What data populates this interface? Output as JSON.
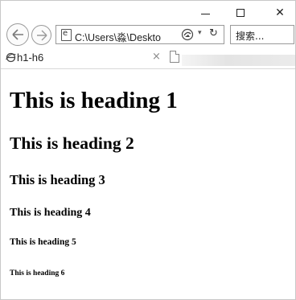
{
  "window": {
    "minimize_icon": "minimize-icon",
    "maximize_icon": "maximize-icon",
    "close_label": "✕"
  },
  "navigation": {
    "back_icon": "back-arrow-icon",
    "forward_icon": "forward-arrow-icon",
    "address": "C:\\Users\\淼\\Deskto",
    "compat_icon": "compatibility-view-icon",
    "dropdown_label": "▾",
    "refresh_label": "↻",
    "search_placeholder": "搜索..."
  },
  "tabs": [
    {
      "title": "h1-h6",
      "close_label": "×",
      "icon": "ie-page-icon"
    }
  ],
  "new_tab_icon": "new-tab-icon",
  "content": {
    "headings": [
      "This is heading 1",
      "This is heading 2",
      "This is heading 3",
      "This is heading 4",
      "This is heading 5",
      "This is heading 6"
    ]
  },
  "colors": {
    "border": "#9a9a9a",
    "text": "#000000"
  }
}
